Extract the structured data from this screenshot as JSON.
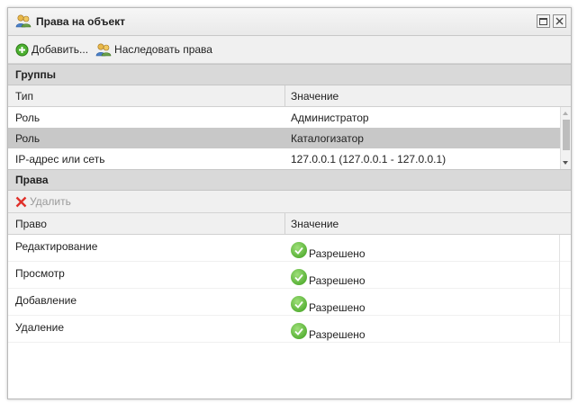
{
  "window": {
    "title": "Права на объект",
    "icons": {
      "title": "users-icon",
      "restore": "restore-icon",
      "close": "close-icon"
    }
  },
  "toolbar": {
    "add_label": "Добавить...",
    "inherit_label": "Наследовать права",
    "icons": {
      "add": "add-icon",
      "inherit": "users-icon"
    }
  },
  "groups": {
    "header": "Группы",
    "columns": [
      "Тип",
      "Значение"
    ],
    "rows": [
      {
        "type": "Роль",
        "value": "Администратор",
        "selected": false
      },
      {
        "type": "Роль",
        "value": "Каталогизатор",
        "selected": true
      },
      {
        "type": "IP-адрес или сеть",
        "value": "127.0.0.1 (127.0.0.1 - 127.0.0.1)",
        "selected": false
      }
    ]
  },
  "rights": {
    "header": "Права",
    "delete_label": "Удалить",
    "delete_icon": "delete-icon",
    "columns": [
      "Право",
      "Значение"
    ],
    "rows": [
      {
        "right": "Редактирование",
        "value": "Разрешено",
        "icon": "check-icon"
      },
      {
        "right": "Просмотр",
        "value": "Разрешено",
        "icon": "check-icon"
      },
      {
        "right": "Добавление",
        "value": "Разрешено",
        "icon": "check-icon"
      },
      {
        "right": "Удаление",
        "value": "Разрешено",
        "icon": "check-icon"
      }
    ]
  },
  "colors": {
    "selected_row": "#c8c8c8",
    "section_header": "#d9d9d9",
    "accent_green": "#3c9e1c",
    "delete_red": "#e0302a"
  }
}
